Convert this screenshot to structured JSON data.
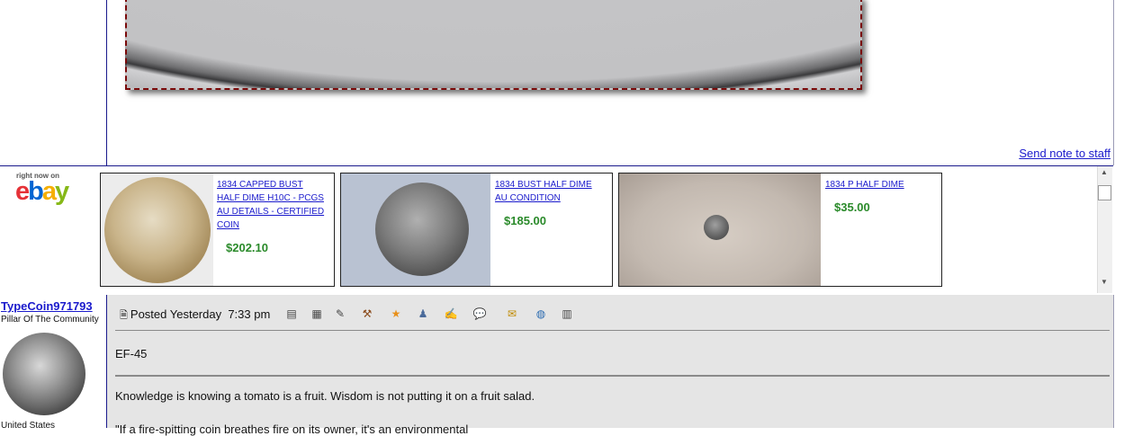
{
  "post": {
    "send_note": "Send note to staff"
  },
  "ebay": {
    "right_now": "right now on",
    "logo_letters": [
      "e",
      "b",
      "a",
      "y"
    ],
    "logo_colors": [
      "#e53238",
      "#0064d2",
      "#f5af02",
      "#86b817"
    ],
    "listings": [
      {
        "title_lines": [
          "1834 CAPPED BUST",
          "HALF DIME H10C - PCGS",
          "AU DETAILS - CERTIFIED",
          "COIN"
        ],
        "price": "$202.10"
      },
      {
        "title_lines": [
          "1834 BUST HALF DIME",
          "AU CONDITION"
        ],
        "price": "$185.00"
      },
      {
        "title_lines": [
          "1834 P HALF DIME"
        ],
        "price": "$35.00"
      }
    ]
  },
  "scrollbar": {
    "up": "▲",
    "down": "▼"
  },
  "reply": {
    "username": "TypeCoin971793",
    "user_title": "Pillar Of The Community",
    "location": "United States",
    "posted_label": "Posted Yesterday  7:33 pm",
    "body": "EF-45",
    "signature": "Knowledge is knowing a tomato is a fruit. Wisdom is not putting it on a fruit salad.",
    "signature_line2": "\"If a fire-spitting coin breathes fire on its owner, it's an environmental"
  },
  "icons": [
    {
      "name": "profile-icon",
      "glyph": "▤",
      "color": "#444"
    },
    {
      "name": "quote-icon",
      "glyph": "▦",
      "color": "#444"
    },
    {
      "name": "edit-icon",
      "glyph": "✎",
      "color": "#444"
    },
    {
      "name": "hammer-icon",
      "glyph": "⚒",
      "color": "#8a4a1a"
    },
    {
      "name": "star-icon",
      "glyph": "★",
      "color": "#e8901a"
    },
    {
      "name": "buddy-icon",
      "glyph": "♟",
      "color": "#4a6a9a"
    },
    {
      "name": "notes-icon",
      "glyph": "✍",
      "color": "#444"
    },
    {
      "name": "chat-icon",
      "glyph": "💬",
      "color": "#444"
    },
    {
      "name": "sticky-note-icon",
      "glyph": "✉",
      "color": "#c08a00"
    },
    {
      "name": "globe-icon",
      "glyph": "◍",
      "color": "#2a6ab0"
    },
    {
      "name": "print-icon",
      "glyph": "▥",
      "color": "#444"
    }
  ]
}
